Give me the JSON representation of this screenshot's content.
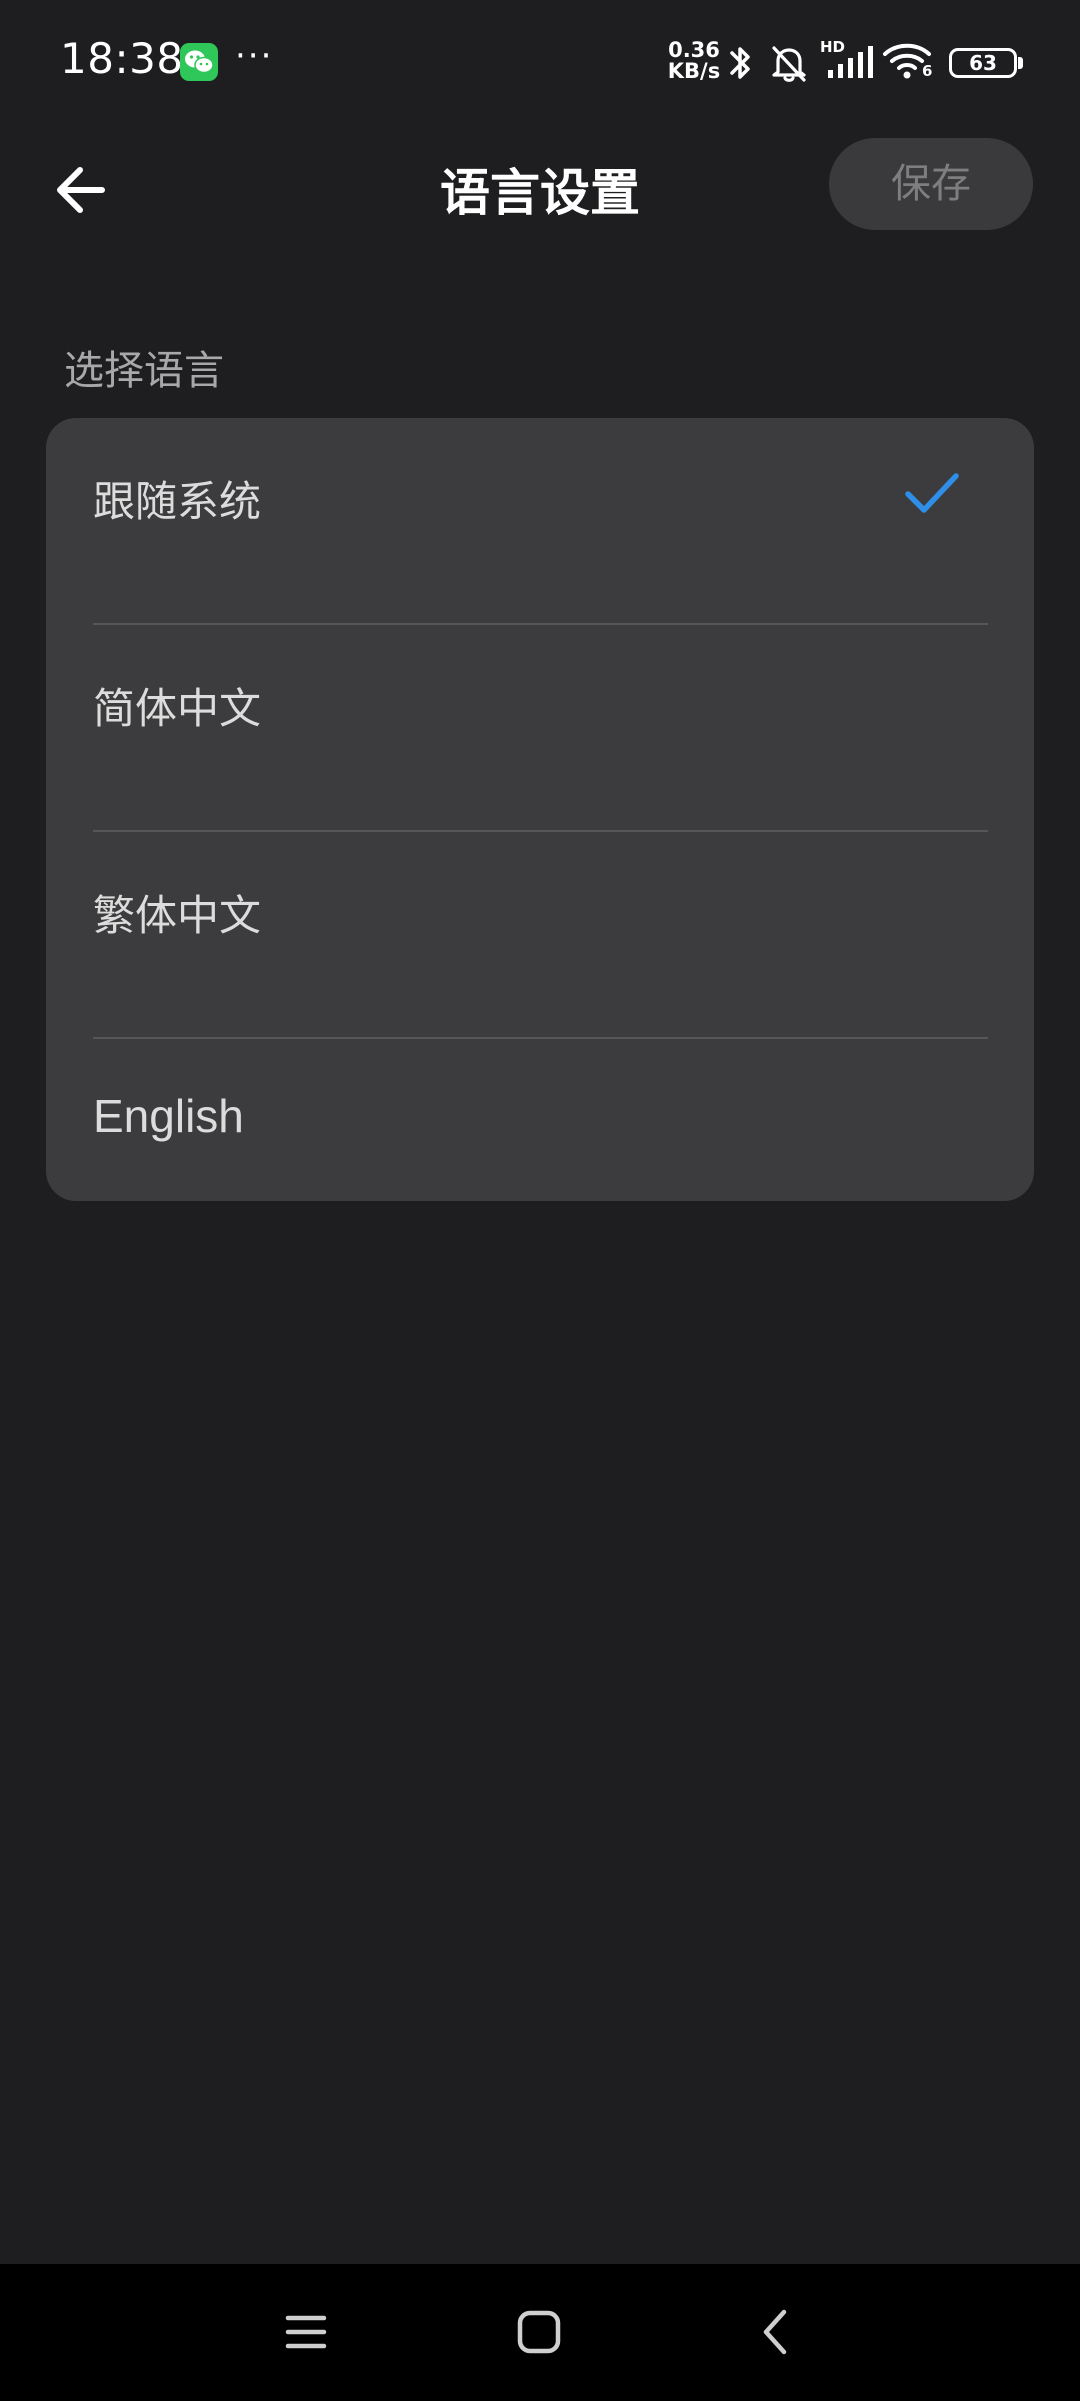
{
  "status_bar": {
    "time": "18:38",
    "more": "···",
    "net_speed_value": "0.36",
    "net_speed_unit": "KB/s",
    "signal_tag": "HD",
    "wifi_tag": "6",
    "battery": "63",
    "icons": [
      "wechat-icon",
      "bluetooth-icon",
      "bell-off-icon",
      "signal-icon",
      "wifi-icon",
      "battery-icon"
    ]
  },
  "app_bar": {
    "title": "语言设置",
    "save_label": "保存"
  },
  "section": {
    "label": "选择语言"
  },
  "languages": [
    {
      "label": "跟随系统",
      "selected": true
    },
    {
      "label": "简体中文",
      "selected": false
    },
    {
      "label": "繁体中文",
      "selected": false
    },
    {
      "label": "English",
      "selected": false
    }
  ],
  "colors": {
    "background": "#1e1e20",
    "card": "#3c3c3e",
    "accent": "#2f8fe8",
    "save_button_bg": "#3a3a3c",
    "save_button_text": "#7e7e80"
  },
  "nav_bar": {
    "icons": [
      "menu-icon",
      "home-icon",
      "back-nav-icon"
    ]
  }
}
